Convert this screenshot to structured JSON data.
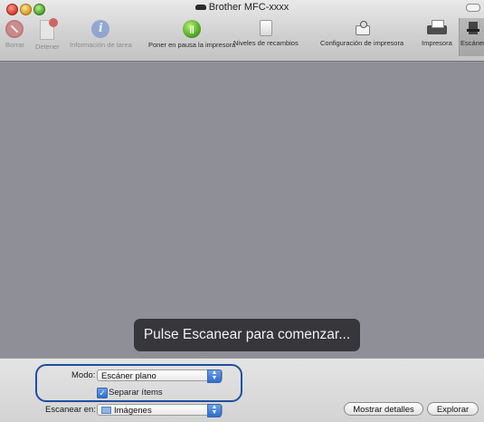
{
  "window": {
    "title": "Brother MFC-xxxx"
  },
  "toolbar": {
    "items": [
      {
        "label": "Borrar",
        "icon": "delete-icon",
        "enabled": false
      },
      {
        "label": "Detener",
        "icon": "stop-icon",
        "enabled": false
      },
      {
        "label": "Información de tarea",
        "icon": "info-icon",
        "enabled": false
      },
      {
        "label": "Poner en pausa la impresora",
        "icon": "pause-icon",
        "enabled": true
      },
      {
        "label": "Niveles de recambios",
        "icon": "ink-cartridge-icon",
        "enabled": true
      },
      {
        "label": "Configuración de impresora",
        "icon": "printer-settings-icon",
        "enabled": true
      },
      {
        "label": "Impresora",
        "icon": "printer-icon",
        "enabled": true
      },
      {
        "label": "Escáner",
        "icon": "scanner-icon",
        "enabled": true,
        "selected": true
      }
    ]
  },
  "preview": {
    "message": "Pulse Escanear para comenzar..."
  },
  "controls": {
    "mode_label": "Modo:",
    "mode_value": "Escáner plano",
    "separate_label": "Separar ítems",
    "separate_checked": true,
    "scan_to_label": "Escanear en:",
    "scan_to_value": "Imágenes",
    "show_details_label": "Mostrar detalles",
    "scan_button_label": "Explorar"
  },
  "colors": {
    "accent": "#1e4f9f",
    "preview_bg": "#8e8f97"
  }
}
